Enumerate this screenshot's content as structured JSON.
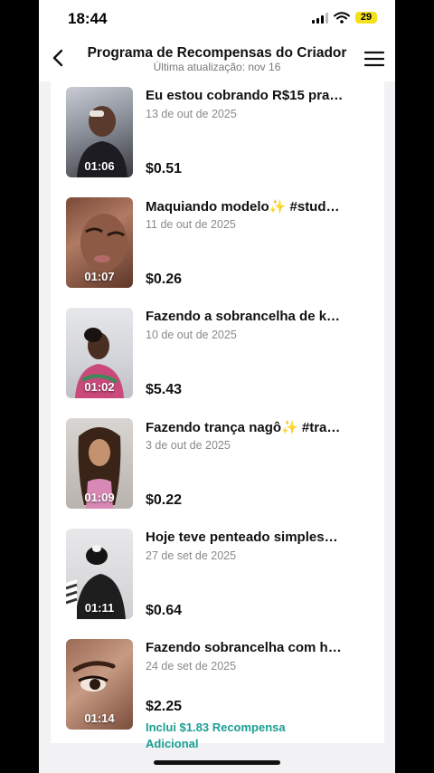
{
  "status": {
    "time": "18:44",
    "battery": "29"
  },
  "header": {
    "title": "Programa de Recompensas do Criador",
    "subtitle": "Última atualização: nov 16"
  },
  "videos": [
    {
      "title": "Eu estou cobrando R$15 pra…",
      "date": "13 de out de 2025",
      "amount": "$0.51",
      "duration": "01:06"
    },
    {
      "title": "Maquiando modelo✨ #stud…",
      "date": "11 de out de 2025",
      "amount": "$0.26",
      "duration": "01:07"
    },
    {
      "title": "Fazendo a sobrancelha de k…",
      "date": "10 de out de 2025",
      "amount": "$5.43",
      "duration": "01:02"
    },
    {
      "title": "Fazendo trança nagô✨ #tra…",
      "date": "3 de out de 2025",
      "amount": "$0.22",
      "duration": "01:09"
    },
    {
      "title": "Hoje teve penteado simples…",
      "date": "27 de set de 2025",
      "amount": "$0.64",
      "duration": "01:11"
    },
    {
      "title": "Fazendo sobrancelha com h…",
      "date": "24 de set de 2025",
      "amount": "$2.25",
      "duration": "01:14",
      "bonus": "Inclui $1.83 Recompensa Adicional"
    }
  ],
  "colors": {
    "bonus_text": "#1a9e93",
    "battery": "#f4e11b"
  }
}
